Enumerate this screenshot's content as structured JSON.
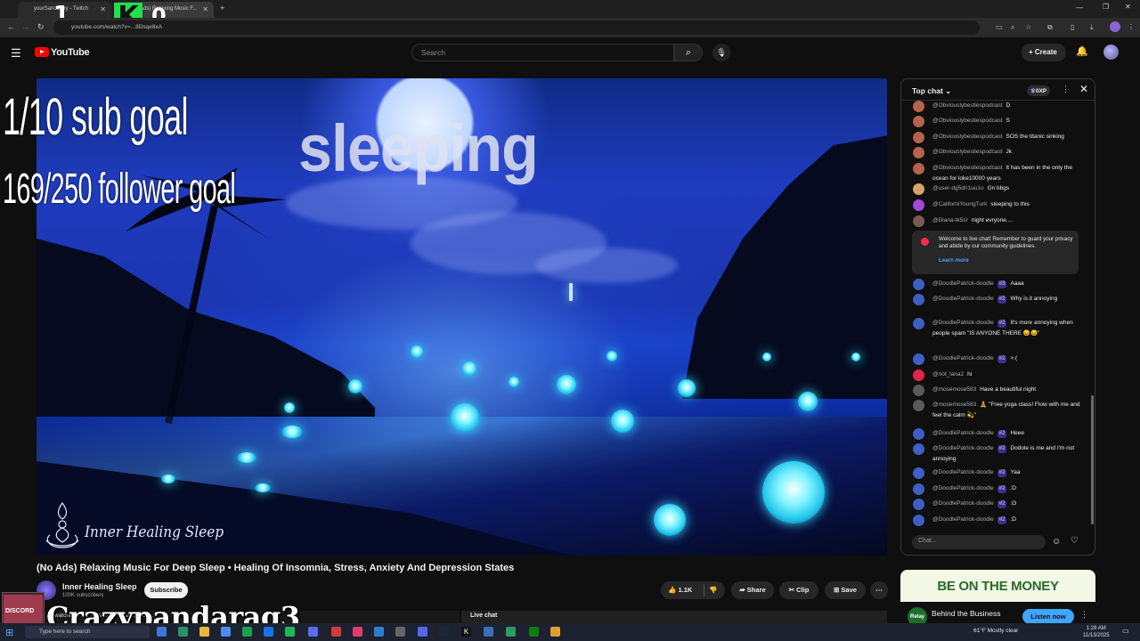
{
  "browser": {
    "tabs": [
      {
        "label": "yourSanctuary - Twitch"
      },
      {
        "label": "(No Ads) Relaxing Music F..."
      }
    ],
    "url": "youtube.com/watch?v=...8Dsqe8xA"
  },
  "stream_overlay": {
    "counter_left": "1",
    "counter_letter": "K",
    "counter_right": "0",
    "sub_goal": "1/10 sub goal",
    "follower_goal": "169/250 follower goal",
    "video_text": "sleeping",
    "streamer_name": "Crazypandarag3",
    "cam_label": "DISCORD",
    "below_text": "watching now · Started streaming on ...",
    "live_chat_label": "Live chat"
  },
  "youtube_header": {
    "brand": "YouTube",
    "search_placeholder": "Search",
    "create_label": "Create"
  },
  "video": {
    "watermark": "Inner Healing Sleep",
    "title": "(No Ads) Relaxing Music For Deep Sleep • Healing Of Insomnia, Stress, Anxiety And Depression States",
    "channel": "Inner Healing Sleep",
    "subscribers": "100K subscribers",
    "subscribe_label": "Subscribe",
    "likes": "1.1K",
    "share_label": "Share",
    "clip_label": "Clip",
    "save_label": "Save"
  },
  "chat": {
    "header": "Top chat",
    "xp": "0XP",
    "welcome": "Welcome to live chat! Remember to guard your privacy and abide by our community guidelines.",
    "learn_more": "Learn more",
    "placeholder": "Chat...",
    "messages": [
      {
        "author": "@Obviouslybestiespodcast",
        "text": "D",
        "color": "#b5624f"
      },
      {
        "author": "@Obviouslybestiespodcast",
        "text": "S",
        "color": "#b5624f"
      },
      {
        "author": "@Obviouslybestiespodcast",
        "text": "SOS the titanic sinking",
        "color": "#b5624f"
      },
      {
        "author": "@Obviouslybestiespodcast",
        "text": "Jk",
        "color": "#b5624f"
      },
      {
        "author": "@Obviouslybestiespodcast",
        "text": "It has been in the only the ocean for loke10000 years",
        "color": "#b5624f"
      },
      {
        "author": "@user-dg5dn1uu1o",
        "text": "Gn bbgs",
        "color": "#d8a36a"
      },
      {
        "author": "@CaliforniYoungTurk",
        "text": "sleeping to this",
        "color": "#a24ad6"
      },
      {
        "author": "@Diana-tk5sr",
        "text": "night evryone....",
        "color": "#7a5b52"
      },
      {
        "author": "@DoodlePatrick-doodle",
        "badge": "#3",
        "text": "Aaaa",
        "color": "#3f5fc4"
      },
      {
        "author": "@DoodlePatrick-doodle",
        "badge": "#2",
        "text": "Why is it annoying",
        "color": "#3f5fc4"
      },
      {
        "author": "@DoodlePatrick-doodle",
        "badge": "#2",
        "text": "It's more annoying when people spam \"IS ANYONE THERE 😖😖\"",
        "color": "#3f5fc4"
      },
      {
        "author": "@DoodlePatrick-doodle",
        "badge": "#2",
        "text": ">:(",
        "color": "#3f5fc4"
      },
      {
        "author": "@not_lana2",
        "text": "hi",
        "color": "#e0244a"
      },
      {
        "author": "@mosemose583",
        "text": "Have a beautiful night",
        "color": "#5a5a5a"
      },
      {
        "author": "@mosemose583",
        "text": "🧘 \"Free yoga class! Flow with me and feel the calm 💫\"",
        "color": "#5a5a5a"
      },
      {
        "author": "@DoodlePatrick-doodle",
        "badge": "#2",
        "text": "Heee",
        "color": "#3f5fc4"
      },
      {
        "author": "@DoodlePatrick-doodle",
        "badge": "#2",
        "text": "Dodole is me and I'm not annoying",
        "color": "#3f5fc4"
      },
      {
        "author": "@DoodlePatrick-doodle",
        "badge": "#2",
        "text": "Yaa",
        "color": "#3f5fc4"
      },
      {
        "author": "@DoodlePatrick-doodle",
        "badge": "#2",
        "text": ":D",
        "color": "#3f5fc4"
      },
      {
        "author": "@DoodlePatrick-doodle",
        "badge": "#2",
        "text": ":O",
        "color": "#3f5fc4"
      },
      {
        "author": "@DoodlePatrick-doodle",
        "badge": "#2",
        "text": ":D",
        "color": "#3f5fc4"
      }
    ]
  },
  "ad": {
    "headline": "BE ON THE MONEY",
    "logo_text": "Relay",
    "advertiser": "Behind the Business",
    "cta": "Listen now"
  },
  "taskbar": {
    "search_placeholder": "Type here to search",
    "weather": "61°F  Mostly clear",
    "time": "1:28 AM",
    "date": "11/13/2025"
  },
  "colors": {
    "youtube_red": "#ff0000",
    "accent_blue": "#3ea6ff",
    "stream_green": "#22e04a"
  }
}
